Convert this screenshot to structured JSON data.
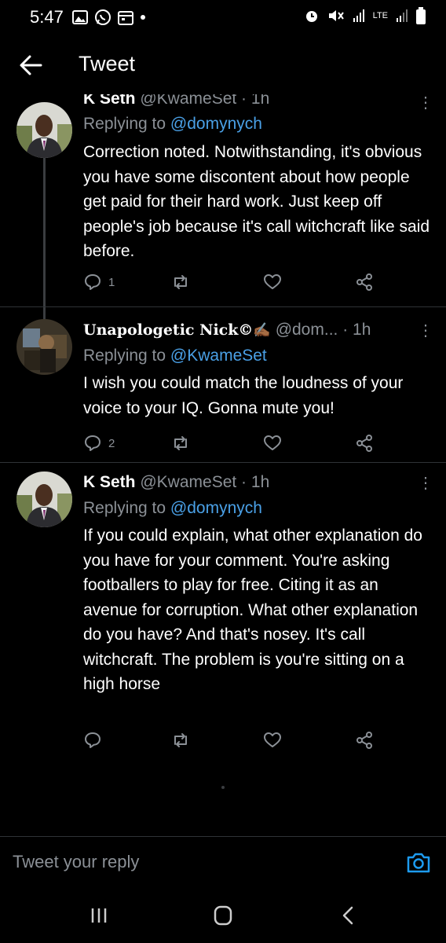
{
  "status_bar": {
    "time": "5:47",
    "left_icons": [
      "gallery-icon",
      "whatsapp-icon",
      "calendar-icon",
      "dot-icon"
    ],
    "right_icons": [
      "alarm-icon",
      "mute-icon",
      "signal-icon",
      "lte-icon",
      "signal-icon",
      "battery-icon"
    ],
    "lte_label": "LTE"
  },
  "header": {
    "title": "Tweet",
    "back_icon": "back-arrow-icon"
  },
  "tweets": [
    {
      "name": "K Seth",
      "handle": "@KwameSet",
      "time": "1h",
      "meta": "@KwameSet · 1h",
      "replying_prefix": "Replying to",
      "replying_to": "@domynych",
      "text": "Correction noted. Notwithstanding, it's obvious you have some discontent about how people get paid for their hard work. Just keep off people's job because it's call witchcraft like said before.",
      "reply_count": "1"
    },
    {
      "name": "Unapologetic Nick©",
      "name_emoji": "✍🏾",
      "handle": "@dom...",
      "time": "1h",
      "meta": "@dom... · 1h",
      "replying_prefix": "Replying to",
      "replying_to": "@KwameSet",
      "text": "I wish you could match the loudness of your voice to your IQ. Gonna mute you!",
      "reply_count": "2"
    },
    {
      "name": "K Seth",
      "handle": "@KwameSet",
      "time": "1h",
      "meta": "@KwameSet · 1h",
      "replying_prefix": "Replying to",
      "replying_to": "@domynych",
      "text": "If you could explain, what other explanation do you have for your comment. You're asking footballers to play for free. Citing it as an avenue for corruption. What other explanation do you have?  And that's nosey. It's call witchcraft. The problem is you're sitting on a high horse",
      "reply_count": ""
    }
  ],
  "reply_bar": {
    "placeholder": "Tweet your reply",
    "camera_icon": "camera-icon"
  },
  "nav_bar": {
    "icons": [
      "recents-icon",
      "home-icon",
      "back-icon"
    ]
  },
  "colors": {
    "background": "#000000",
    "accent": "#1d9bf0",
    "mention": "#4aa0e6",
    "muted": "#8b9096"
  }
}
